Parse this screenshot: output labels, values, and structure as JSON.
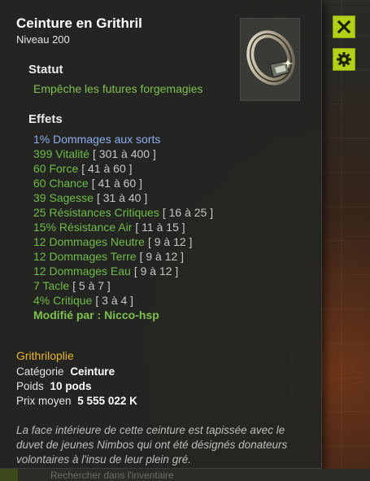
{
  "item": {
    "name": "Ceinture en Grithril",
    "level": "Niveau  200"
  },
  "statut": {
    "heading": "Statut",
    "text": "Empêche les futures forgemagies"
  },
  "effets": {
    "heading": "Effets",
    "items": [
      {
        "value": "1% Dommages aux sorts",
        "range": "",
        "color": "#8eaef0"
      },
      {
        "value": "399 Vitalité",
        "range": "[ 301 à 400 ]"
      },
      {
        "value": "60 Force",
        "range": "[ 41 à 60 ]"
      },
      {
        "value": "60 Chance",
        "range": "[ 41 à 60 ]"
      },
      {
        "value": "39 Sagesse",
        "range": "[ 31 à 40 ]"
      },
      {
        "value": "25 Résistances Critiques",
        "range": "[ 16 à 25 ]"
      },
      {
        "value": "15% Résistance Air",
        "range": "[ 11 à 15 ]"
      },
      {
        "value": "12 Dommages Neutre",
        "range": "[ 9 à 12 ]"
      },
      {
        "value": "12 Dommages Terre",
        "range": "[ 9 à 12 ]"
      },
      {
        "value": "12 Dommages Eau",
        "range": "[ 9 à 12 ]"
      },
      {
        "value": "7 Tacle",
        "range": "[ 5 à 7 ]"
      },
      {
        "value": "4% Critique",
        "range": "[ 3 à 4 ]"
      }
    ],
    "modified_by": "Modifié par : Nicco-hsp"
  },
  "set_name": "Grithriloplie",
  "details": {
    "category_label": "Catégorie",
    "category_value": "Ceinture",
    "weight_label": "Poids",
    "weight_value": "10 pods",
    "price_label": "Prix moyen",
    "price_value": "5 555 022 K"
  },
  "description": "La face intérieure de cette ceinture est tapissée avec le duvet de jeunes Nimbos qui ont été désignés donateurs volontaires à l'insu de leur plein gré.",
  "buttons": {
    "close_icon": "close-icon",
    "settings_icon": "gear-icon"
  },
  "inventory_search_placeholder": "Rechercher dans l'inventaire",
  "colors": {
    "accent_button": "#b5d117",
    "effect_green": "#6fbb47",
    "effect_blue": "#8eaef0",
    "set_gold": "#e8b628"
  }
}
